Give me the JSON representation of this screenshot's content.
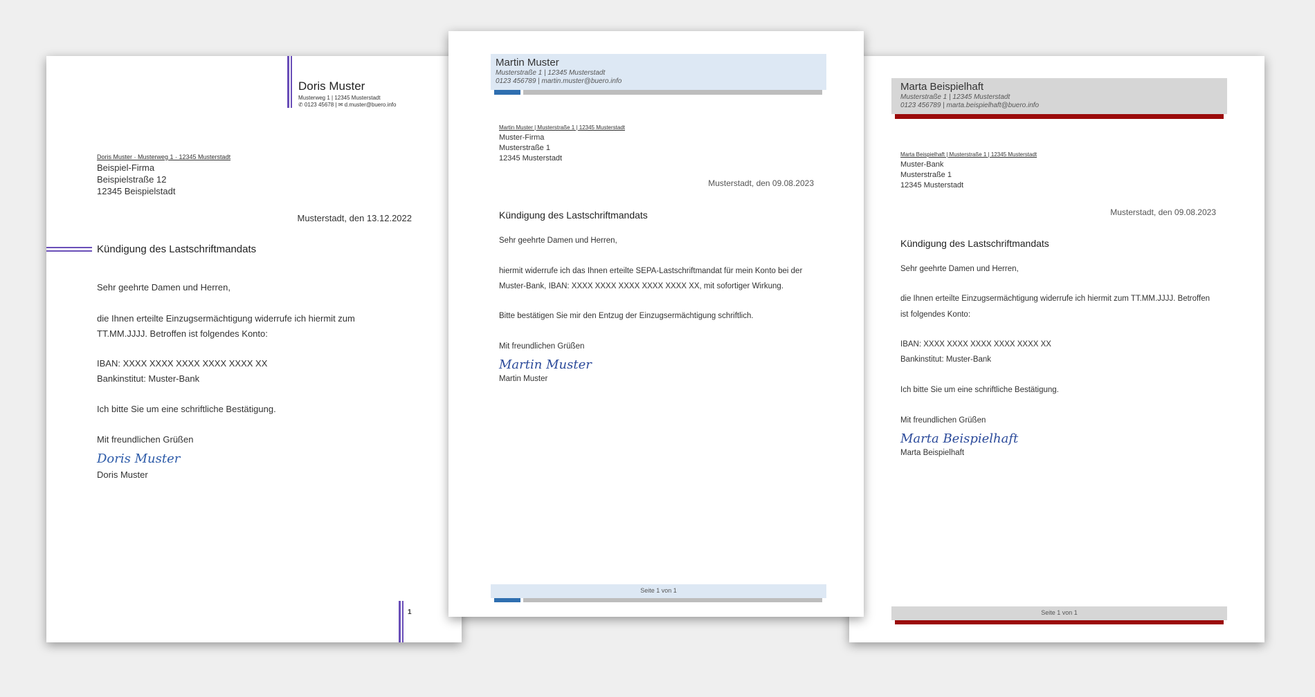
{
  "letter1": {
    "sender_name": "Doris Muster",
    "sender_address": "Musterweg 1 | 12345 Musterstadt",
    "sender_contact": "✆ 0123 45678 | ✉ d.muster@buero.info",
    "return_line": "Doris Muster · Musterweg 1 · 12345 Musterstadt",
    "recipient": [
      "Beispiel-Firma",
      "Beispielstraße 12",
      "12345 Beispielstadt"
    ],
    "date": "Musterstadt, den 13.12.2022",
    "subject": "Kündigung des Lastschriftmandats",
    "salutation": "Sehr geehrte Damen und Herren,",
    "body_line1": "die Ihnen erteilte Einzugsermächtigung widerrufe ich hiermit zum",
    "body_line2": "TT.MM.JJJJ. Betroffen ist folgendes Konto:",
    "iban": "IBAN: XXXX XXXX XXXX XXXX XXXX XX",
    "bank": "Bankinstitut: Muster-Bank",
    "confirm": "Ich bitte Sie um eine schriftliche Bestätigung.",
    "closing": "Mit freundlichen Grüßen",
    "signature": "Doris Muster",
    "printed_name": "Doris Muster",
    "page_number": "1",
    "accent_color": "#6a4fb8"
  },
  "letter2": {
    "sender_name": "Martin Muster",
    "sender_address": "Musterstraße 1 | 12345 Musterstadt",
    "sender_contact": "0123 456789 | martin.muster@buero.info",
    "return_line": "Martin Muster | Musterstraße 1 | 12345 Musterstadt",
    "recipient": [
      "Muster-Firma",
      "Musterstraße 1",
      "12345 Musterstadt"
    ],
    "date": "Musterstadt, den 09.08.2023",
    "subject": "Kündigung des Lastschriftmandats",
    "salutation": "Sehr geehrte Damen und Herren,",
    "body_line1": "hiermit widerrufe ich das Ihnen erteilte SEPA-Lastschriftmandat für mein Konto bei der",
    "body_line2": "Muster-Bank, IBAN: XXXX XXXX XXXX XXXX XXXX XX, mit sofortiger Wirkung.",
    "confirm": "Bitte bestätigen Sie mir den Entzug der Einzugsermächtigung schriftlich.",
    "closing": "Mit freundlichen Grüßen",
    "signature": "Martin Muster",
    "printed_name": "Martin Muster",
    "footer": "Seite 1 von 1",
    "header_bg": "#dde8f4",
    "accent_color": "#2f6fb0"
  },
  "letter3": {
    "sender_name": "Marta Beispielhaft",
    "sender_address": "Musterstraße 1 | 12345 Musterstadt",
    "sender_contact": "0123 456789 | marta.beispielhaft@buero.info",
    "return_line": "Marta Beispielhaft | Musterstraße 1 | 12345 Musterstadt",
    "recipient": [
      "Muster-Bank",
      "Musterstraße 1",
      "12345 Musterstadt"
    ],
    "date": "Musterstadt, den 09.08.2023",
    "subject": "Kündigung des Lastschriftmandats",
    "salutation": "Sehr geehrte Damen und Herren,",
    "body_line1": "die Ihnen erteilte Einzugsermächtigung widerrufe ich hiermit zum TT.MM.JJJJ. Betroffen",
    "body_line2": "ist folgendes Konto:",
    "iban": "IBAN: XXXX XXXX XXXX XXXX XXXX XX",
    "bank": "Bankinstitut: Muster-Bank",
    "confirm": "Ich bitte Sie um eine schriftliche Bestätigung.",
    "closing": "Mit freundlichen Grüßen",
    "signature": "Marta Beispielhaft",
    "printed_name": "Marta Beispielhaft",
    "footer": "Seite 1 von 1",
    "header_bg": "#d6d6d6",
    "accent_color": "#9b0b0b"
  }
}
